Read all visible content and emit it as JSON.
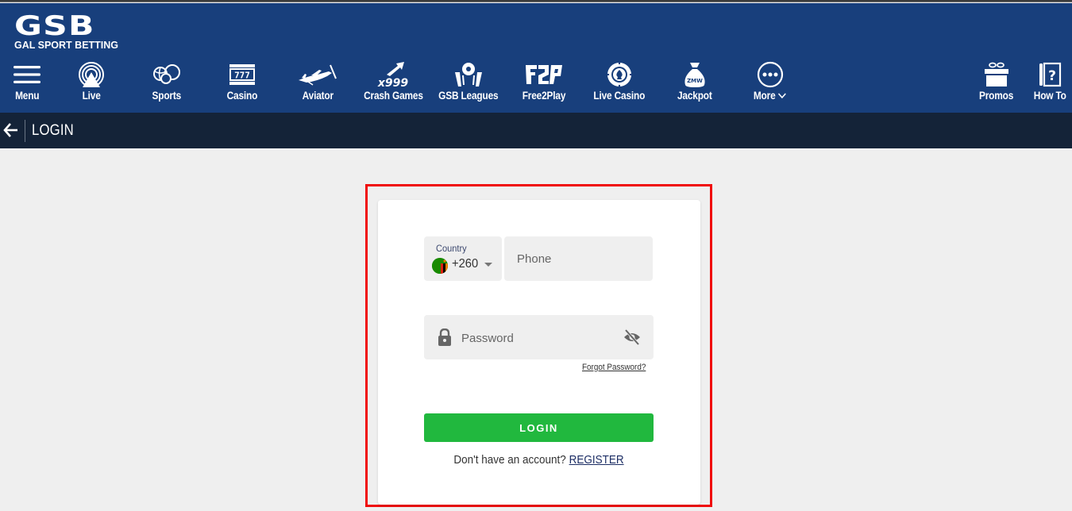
{
  "brand": {
    "logo_text": "GSB",
    "logo_subtext": "GAL SPORT BETTING",
    "header_color": "#183f7c",
    "subheader_color": "#142338",
    "accent_green": "#21b83e",
    "highlight_color": "#f00a0a"
  },
  "nav": {
    "items": [
      {
        "label": "Menu",
        "icon": "hamburger-icon"
      },
      {
        "label": "Live",
        "icon": "live-broadcast-icon"
      },
      {
        "label": "Sports",
        "icon": "sports-balls-icon"
      },
      {
        "label": "Casino",
        "icon": "slot-machine-icon"
      },
      {
        "label": "Aviator",
        "icon": "airplane-icon"
      },
      {
        "label": "Crash Games",
        "icon": "crash-arrow-icon"
      },
      {
        "label": "GSB Leagues",
        "icon": "league-trophy-icon"
      },
      {
        "label": "Free2Play",
        "icon": "f2p-icon"
      },
      {
        "label": "Live Casino",
        "icon": "casino-chip-icon"
      },
      {
        "label": "Jackpot",
        "icon": "money-bag-icon"
      },
      {
        "label": "More",
        "icon": "more-dots-icon"
      },
      {
        "label": "Promos",
        "icon": "gift-icon"
      },
      {
        "label": "How To",
        "icon": "help-book-icon"
      }
    ],
    "jackpot_bag_text": "ZMW",
    "crash_multiplier_text": "x999",
    "slot_text": "777"
  },
  "subheader": {
    "title": "LOGIN"
  },
  "login_form": {
    "country_label": "Country",
    "country_code": "+260",
    "country_flag": "zambia-flag",
    "phone_placeholder": "Phone",
    "phone_value": "",
    "password_placeholder": "Password",
    "password_value": "",
    "forgot_password": "Forgot Password?",
    "login_button": "LOGIN",
    "no_account_text": "Don't have an account?",
    "register_link": "REGISTER"
  }
}
